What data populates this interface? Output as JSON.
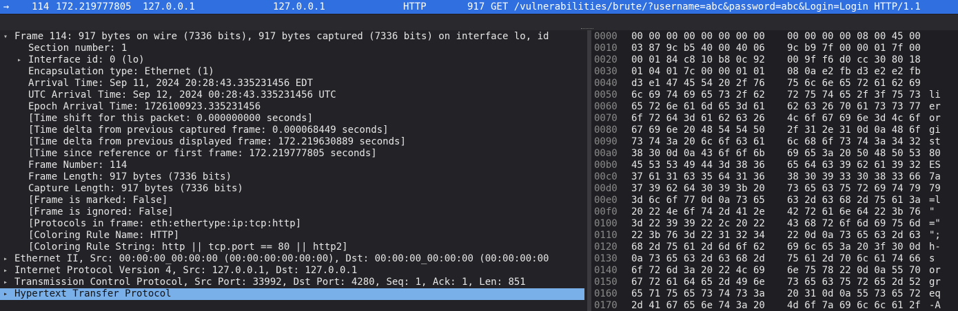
{
  "packet_list": {
    "selected_row": {
      "no": "114",
      "time": "172.219777805",
      "source": "127.0.0.1",
      "destination": "127.0.0.1",
      "protocol": "HTTP",
      "length": "917",
      "info": "GET /vulnerabilities/brute/?username=abc&password=abc&Login=Login HTTP/1.1"
    }
  },
  "details": {
    "rows": [
      {
        "indent": 0,
        "expander": "expanded",
        "text": "Frame 114: 917 bytes on wire (7336 bits), 917 bytes captured (7336 bits) on interface lo, id"
      },
      {
        "indent": 1,
        "expander": "none",
        "text": "Section number: 1"
      },
      {
        "indent": 1,
        "expander": "collapsed",
        "text": "Interface id: 0 (lo)"
      },
      {
        "indent": 1,
        "expander": "none",
        "text": "Encapsulation type: Ethernet (1)"
      },
      {
        "indent": 1,
        "expander": "none",
        "text": "Arrival Time: Sep 11, 2024 20:28:43.335231456 EDT"
      },
      {
        "indent": 1,
        "expander": "none",
        "text": "UTC Arrival Time: Sep 12, 2024 00:28:43.335231456 UTC"
      },
      {
        "indent": 1,
        "expander": "none",
        "text": "Epoch Arrival Time: 1726100923.335231456"
      },
      {
        "indent": 1,
        "expander": "none",
        "text": "[Time shift for this packet: 0.000000000 seconds]"
      },
      {
        "indent": 1,
        "expander": "none",
        "text": "[Time delta from previous captured frame: 0.000068449 seconds]"
      },
      {
        "indent": 1,
        "expander": "none",
        "text": "[Time delta from previous displayed frame: 172.219630889 seconds]"
      },
      {
        "indent": 1,
        "expander": "none",
        "text": "[Time since reference or first frame: 172.219777805 seconds]"
      },
      {
        "indent": 1,
        "expander": "none",
        "text": "Frame Number: 114"
      },
      {
        "indent": 1,
        "expander": "none",
        "text": "Frame Length: 917 bytes (7336 bits)"
      },
      {
        "indent": 1,
        "expander": "none",
        "text": "Capture Length: 917 bytes (7336 bits)"
      },
      {
        "indent": 1,
        "expander": "none",
        "text": "[Frame is marked: False]"
      },
      {
        "indent": 1,
        "expander": "none",
        "text": "[Frame is ignored: False]"
      },
      {
        "indent": 1,
        "expander": "none",
        "text": "[Protocols in frame: eth:ethertype:ip:tcp:http]"
      },
      {
        "indent": 1,
        "expander": "none",
        "text": "[Coloring Rule Name: HTTP]"
      },
      {
        "indent": 1,
        "expander": "none",
        "text": "[Coloring Rule String: http || tcp.port == 80 || http2]"
      },
      {
        "indent": 0,
        "expander": "collapsed",
        "text": "Ethernet II, Src: 00:00:00_00:00:00 (00:00:00:00:00:00), Dst: 00:00:00_00:00:00 (00:00:00:00"
      },
      {
        "indent": 0,
        "expander": "collapsed",
        "text": "Internet Protocol Version 4, Src: 127.0.0.1, Dst: 127.0.0.1"
      },
      {
        "indent": 0,
        "expander": "collapsed",
        "text": "Transmission Control Protocol, Src Port: 33992, Dst Port: 4280, Seq: 1, Ack: 1, Len: 851"
      },
      {
        "indent": 0,
        "expander": "collapsed",
        "text": "Hypertext Transfer Protocol",
        "selected": true
      }
    ]
  },
  "hex": {
    "rows": [
      {
        "offset": "0000",
        "b1": "00 00 00 00 00 00 00 00",
        "b2": "00 00 00 00 08 00 45 00",
        "ascii": ""
      },
      {
        "offset": "0010",
        "b1": "03 87 9c b5 40 00 40 06",
        "b2": "9c b9 7f 00 00 01 7f 00",
        "ascii": ""
      },
      {
        "offset": "0020",
        "b1": "00 01 84 c8 10 b8 0c 92",
        "b2": "00 9f f6 d0 cc 30 80 18",
        "ascii": ""
      },
      {
        "offset": "0030",
        "b1": "01 04 01 7c 00 00 01 01",
        "b2": "08 0a e2 fb d3 e2 e2 fb",
        "ascii": ""
      },
      {
        "offset": "0040",
        "b1": "d3 e1 47 45 54 20 2f 76",
        "b2": "75 6c 6e 65 72 61 62 69",
        "ascii": ""
      },
      {
        "offset": "0050",
        "b1": "6c 69 74 69 65 73 2f 62",
        "b2": "72 75 74 65 2f 3f 75 73",
        "ascii": "li"
      },
      {
        "offset": "0060",
        "b1": "65 72 6e 61 6d 65 3d 61",
        "b2": "62 63 26 70 61 73 73 77",
        "ascii": "er"
      },
      {
        "offset": "0070",
        "b1": "6f 72 64 3d 61 62 63 26",
        "b2": "4c 6f 67 69 6e 3d 4c 6f",
        "ascii": "or"
      },
      {
        "offset": "0080",
        "b1": "67 69 6e 20 48 54 54 50",
        "b2": "2f 31 2e 31 0d 0a 48 6f",
        "ascii": "gi"
      },
      {
        "offset": "0090",
        "b1": "73 74 3a 20 6c 6f 63 61",
        "b2": "6c 68 6f 73 74 3a 34 32",
        "ascii": "st"
      },
      {
        "offset": "00a0",
        "b1": "38 30 0d 0a 43 6f 6f 6b",
        "b2": "69 65 3a 20 50 48 50 53",
        "ascii": "80"
      },
      {
        "offset": "00b0",
        "b1": "45 53 53 49 44 3d 38 36",
        "b2": "65 64 63 39 62 61 39 32",
        "ascii": "ES"
      },
      {
        "offset": "00c0",
        "b1": "37 61 31 63 35 64 31 36",
        "b2": "38 30 39 33 30 38 33 66",
        "ascii": "7a"
      },
      {
        "offset": "00d0",
        "b1": "37 39 62 64 30 39 3b 20",
        "b2": "73 65 63 75 72 69 74 79",
        "ascii": "79"
      },
      {
        "offset": "00e0",
        "b1": "3d 6c 6f 77 0d 0a 73 65",
        "b2": "63 2d 63 68 2d 75 61 3a",
        "ascii": "=l"
      },
      {
        "offset": "00f0",
        "b1": "20 22 4e 6f 74 2d 41 2e",
        "b2": "42 72 61 6e 64 22 3b 76",
        "ascii": "\""
      },
      {
        "offset": "0100",
        "b1": "3d 22 39 39 22 2c 20 22",
        "b2": "43 68 72 6f 6d 69 75 6d",
        "ascii": "=\""
      },
      {
        "offset": "0110",
        "b1": "22 3b 76 3d 22 31 32 34",
        "b2": "22 0d 0a 73 65 63 2d 63",
        "ascii": "\";"
      },
      {
        "offset": "0120",
        "b1": "68 2d 75 61 2d 6d 6f 62",
        "b2": "69 6c 65 3a 20 3f 30 0d",
        "ascii": "h-"
      },
      {
        "offset": "0130",
        "b1": "0a 73 65 63 2d 63 68 2d",
        "b2": "75 61 2d 70 6c 61 74 66",
        "ascii": "s"
      },
      {
        "offset": "0140",
        "b1": "6f 72 6d 3a 20 22 4c 69",
        "b2": "6e 75 78 22 0d 0a 55 70",
        "ascii": "or"
      },
      {
        "offset": "0150",
        "b1": "67 72 61 64 65 2d 49 6e",
        "b2": "73 65 63 75 72 65 2d 52",
        "ascii": "gr"
      },
      {
        "offset": "0160",
        "b1": "65 71 75 65 73 74 73 3a",
        "b2": "20 31 0d 0a 55 73 65 72",
        "ascii": "eq"
      },
      {
        "offset": "0170",
        "b1": "2d 41 67 65 6e 74 3a 20",
        "b2": "4d 6f 7a 69 6c 6c 61 2f",
        "ascii": "-A"
      }
    ]
  }
}
